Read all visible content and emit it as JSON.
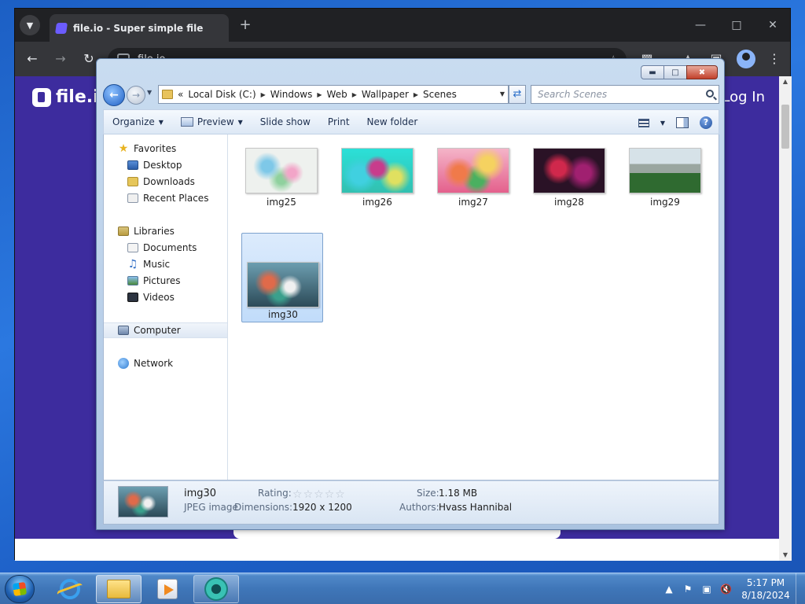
{
  "browser": {
    "tab_title": "file.io - Super simple file sharing",
    "new_tab": "+",
    "url": "file.io",
    "page_logo": "file.io",
    "page_login": "Log In"
  },
  "explorer": {
    "breadcrumb": [
      "Local Disk (C:)",
      "Windows",
      "Web",
      "Wallpaper",
      "Scenes"
    ],
    "breadcrumb_prefix": "«",
    "search_placeholder": "Search Scenes",
    "toolbar": {
      "organize": "Organize",
      "preview": "Preview",
      "slideshow": "Slide show",
      "print": "Print",
      "new_folder": "New folder"
    },
    "nav": {
      "favorites": "Favorites",
      "desktop": "Desktop",
      "downloads": "Downloads",
      "recent": "Recent Places",
      "libraries": "Libraries",
      "documents": "Documents",
      "music": "Music",
      "pictures": "Pictures",
      "videos": "Videos",
      "computer": "Computer",
      "network": "Network"
    },
    "files": [
      {
        "name": "img25"
      },
      {
        "name": "img26"
      },
      {
        "name": "img27"
      },
      {
        "name": "img28"
      },
      {
        "name": "img29"
      },
      {
        "name": "img30"
      }
    ],
    "details": {
      "name": "img30",
      "type": "JPEG image",
      "rating_label": "Rating:",
      "rating_value": 0,
      "dimensions_label": "Dimensions:",
      "dimensions_value": "1920 x 1200",
      "size_label": "Size:",
      "size_value": "1.18 MB",
      "authors_label": "Authors:",
      "authors_value": "Hvass Hannibal"
    }
  },
  "taskbar": {
    "time": "5:17 PM",
    "date": "8/18/2024"
  },
  "colors": {
    "fileio_brand": "#3d2c9e",
    "selection": "#c1dcfa",
    "taskbar": "#3f76b8"
  }
}
